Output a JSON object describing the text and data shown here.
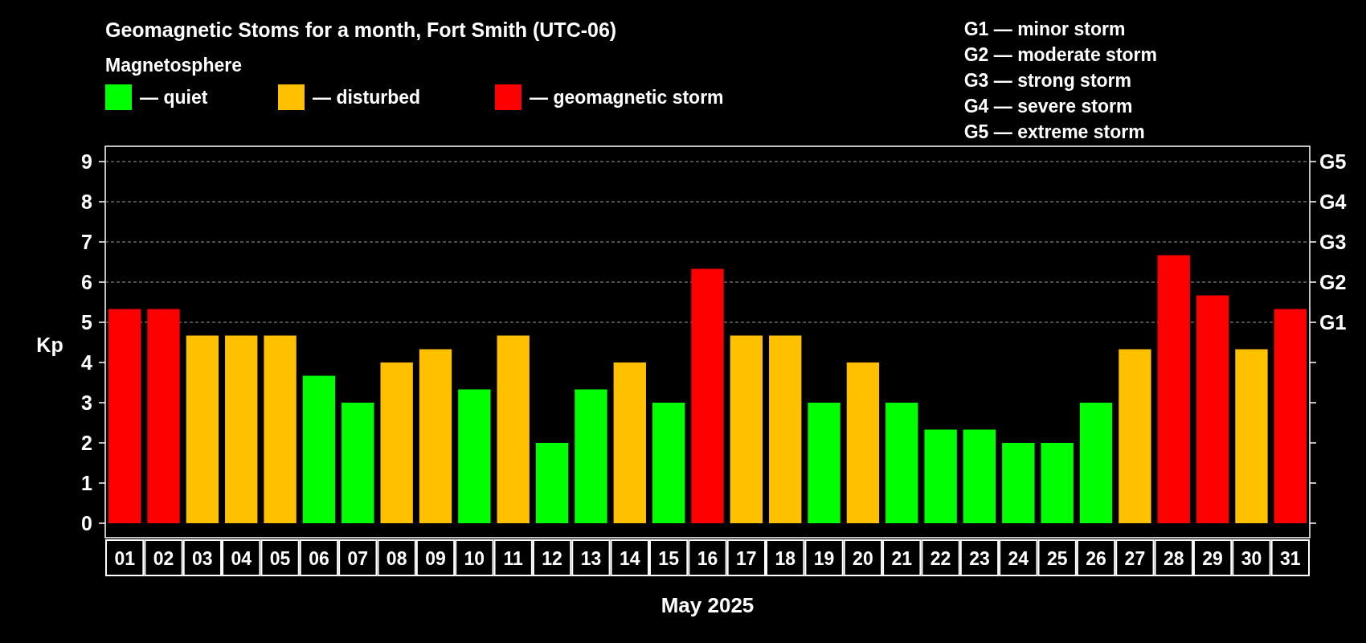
{
  "title": "Geomagnetic Stoms for a month, Fort Smith (UTC-06)",
  "legend": {
    "heading": "Magnetosphere"
  },
  "storm_scale": [
    "G1 — minor storm",
    "G2 — moderate storm",
    "G3 — strong storm",
    "G4 — severe storm",
    "G5 — extreme storm"
  ],
  "chart": {
    "right_axis_labels": [
      "G5",
      "G4",
      "G3",
      "G2",
      "G1"
    ],
    "chart_data": {
      "type": "bar",
      "xlabel": "May 2025",
      "ylabel": "Kp",
      "grid": true,
      "categories": [
        "01",
        "02",
        "03",
        "04",
        "05",
        "06",
        "07",
        "08",
        "09",
        "10",
        "11",
        "12",
        "13",
        "14",
        "15",
        "16",
        "17",
        "18",
        "19",
        "20",
        "21",
        "22",
        "23",
        "24",
        "25",
        "26",
        "27",
        "28",
        "29",
        "30",
        "31"
      ],
      "series": [
        {
          "name": "— quiet",
          "color": "#00ff00",
          "values": [
            null,
            null,
            null,
            null,
            null,
            3.67,
            3,
            null,
            null,
            3.33,
            null,
            2,
            3.33,
            null,
            3,
            null,
            null,
            null,
            3,
            null,
            3,
            2.33,
            2.33,
            2,
            2,
            3,
            null,
            null,
            null,
            null,
            null
          ]
        },
        {
          "name": "— disturbed",
          "color": "#ffc000",
          "values": [
            null,
            null,
            4.67,
            4.67,
            4.67,
            null,
            null,
            4,
            4.33,
            null,
            4.67,
            null,
            null,
            4,
            null,
            null,
            4.67,
            4.67,
            null,
            4,
            null,
            null,
            null,
            null,
            null,
            null,
            4.33,
            null,
            null,
            4.33,
            null
          ]
        },
        {
          "name": "— geomagnetic storm",
          "color": "#ff0000",
          "values": [
            5.33,
            5.33,
            null,
            null,
            null,
            null,
            null,
            null,
            null,
            null,
            null,
            null,
            null,
            null,
            null,
            6.33,
            null,
            null,
            null,
            null,
            null,
            null,
            null,
            null,
            null,
            null,
            null,
            6.67,
            5.67,
            null,
            5.33
          ]
        }
      ],
      "ylim": [
        -0.36,
        9.38
      ],
      "yticks": [
        0,
        1,
        2,
        3,
        4,
        5,
        6,
        7,
        8,
        9
      ]
    }
  }
}
